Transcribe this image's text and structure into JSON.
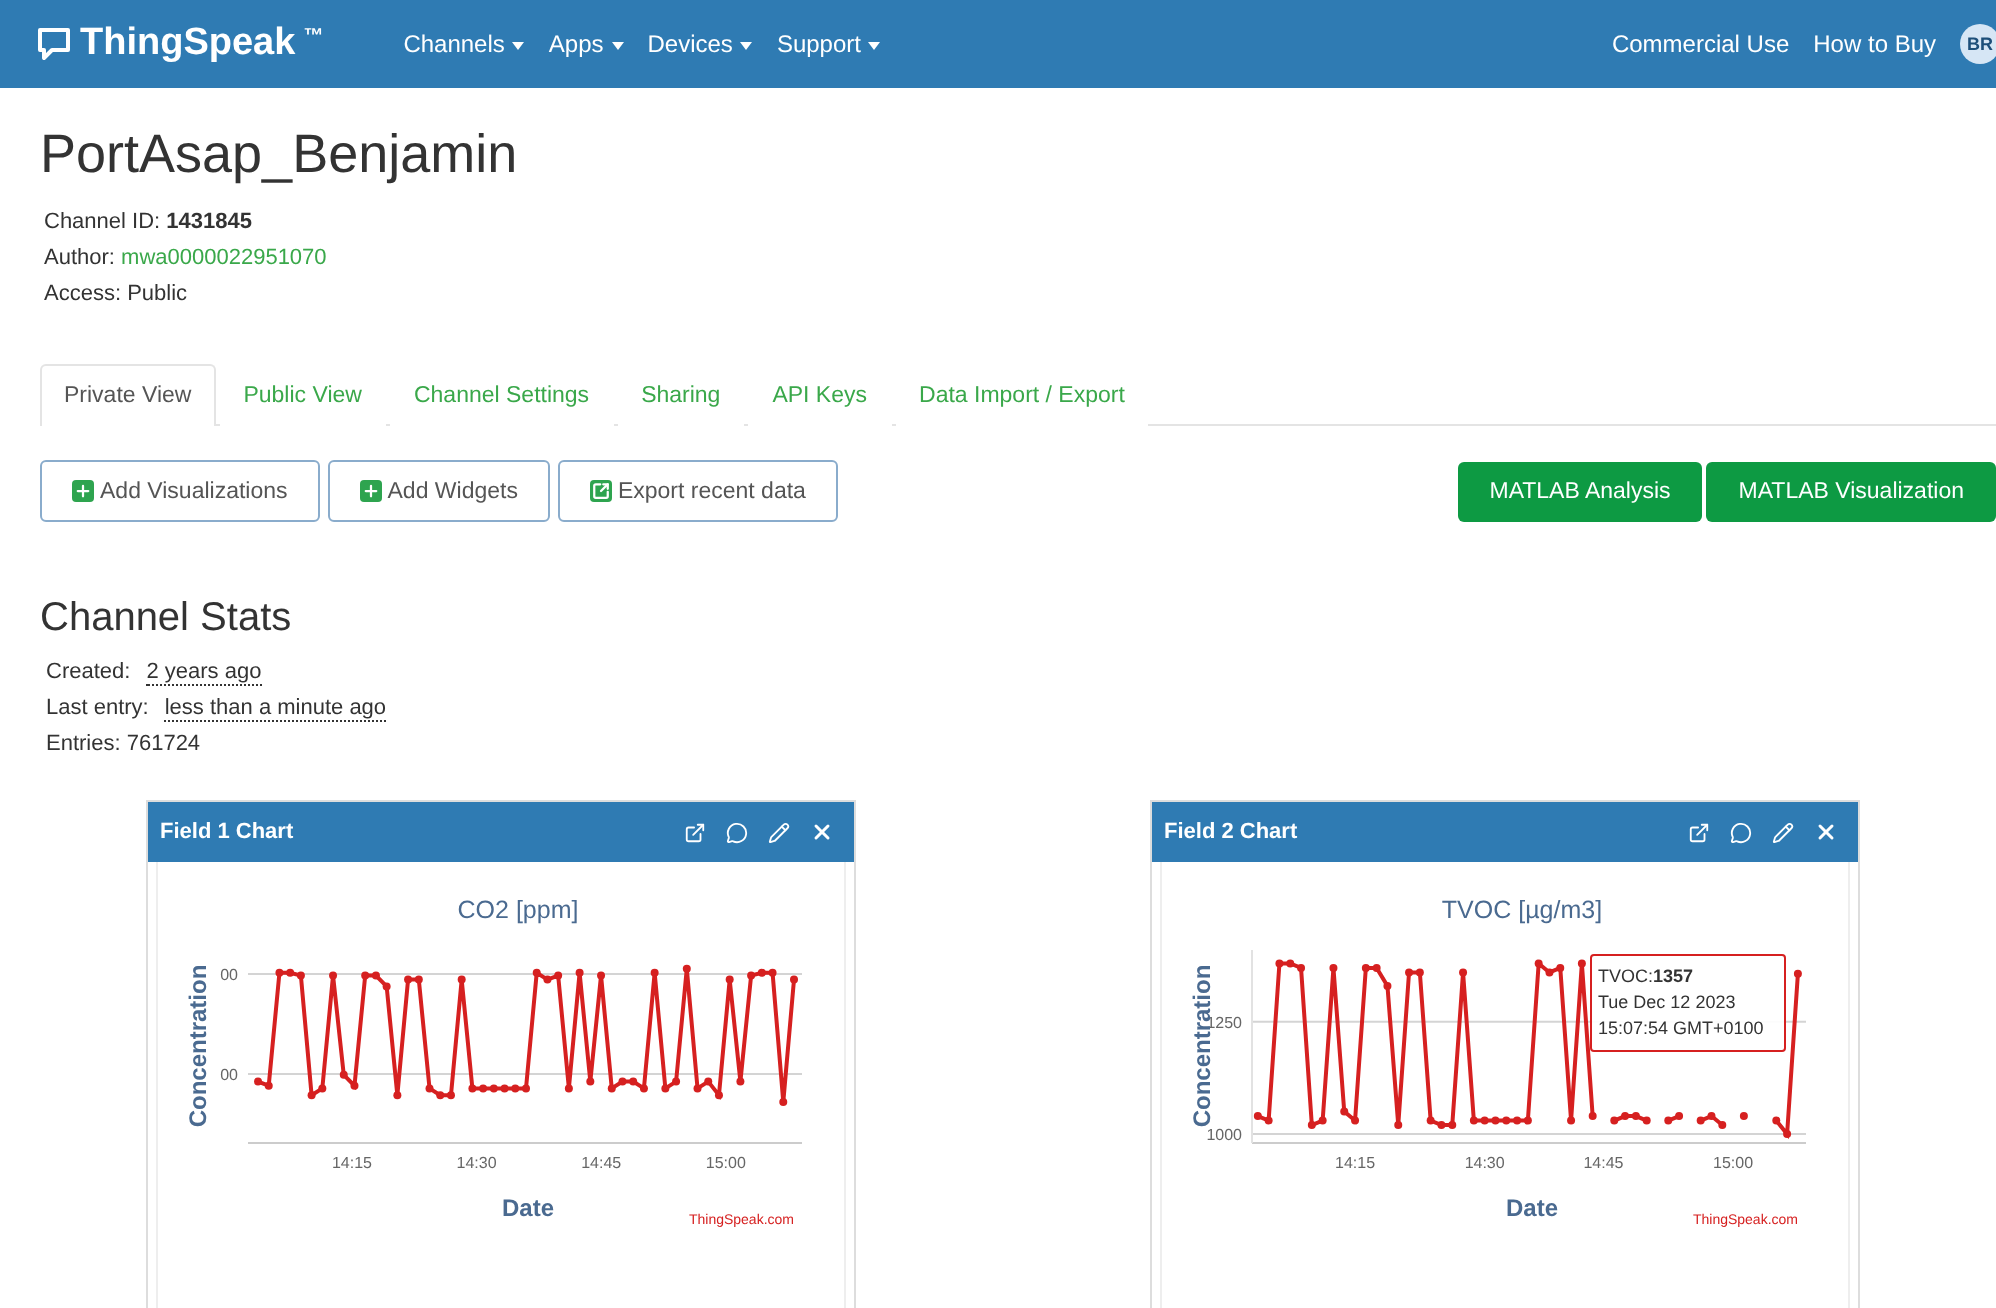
{
  "navbar": {
    "brand": "ThingSpeak",
    "trademark": "™",
    "menus": [
      {
        "label": "Channels"
      },
      {
        "label": "Apps"
      },
      {
        "label": "Devices"
      },
      {
        "label": "Support"
      }
    ],
    "links": [
      "Commercial Use",
      "How to Buy"
    ],
    "avatar": "BR"
  },
  "channel": {
    "title": "PortAsap_Benjamin",
    "id_label": "Channel ID:",
    "id": "1431845",
    "author_label": "Author:",
    "author": "mwa0000022951070",
    "access": "Access: Public"
  },
  "tabs": [
    {
      "label": "Private View",
      "selected": true
    },
    {
      "label": "Public View",
      "selected": false
    },
    {
      "label": "Channel Settings",
      "selected": false
    },
    {
      "label": "Sharing",
      "selected": false
    },
    {
      "label": "API Keys",
      "selected": false
    },
    {
      "label": "Data Import / Export",
      "selected": false
    }
  ],
  "actions": [
    {
      "label": "Add Visualizations",
      "kind": "add"
    },
    {
      "label": "Add Widgets",
      "kind": "add"
    },
    {
      "label": "Export recent data",
      "kind": "export"
    }
  ],
  "matlab_buttons": [
    "MATLAB Analysis",
    "MATLAB Visualization"
  ],
  "stats": {
    "title": "Channel Stats",
    "created_label": "Created:",
    "created": "2 years ago",
    "last_label": "Last entry:",
    "last": "less than a minute ago",
    "entries": "Entries: 761724"
  },
  "charts": [
    {
      "header": "Field 1 Chart",
      "title": "CO2 [ppm]",
      "xlabel": "Date",
      "ylabel": "Concentration",
      "x_tick_labels": [
        "14:15",
        "14:30",
        "14:45",
        "15:00"
      ],
      "y_tick_labels": [
        "00",
        "00"
      ],
      "credit": "ThingSpeak.com"
    },
    {
      "header": "Field 2 Chart",
      "credit": "ThingSpeak.com",
      "chart_data": {
        "type": "line",
        "title": "TVOC [µg/m3]",
        "xlabel": "Date",
        "ylabel": "Concentration",
        "categories": [
          null,
          null,
          null,
          null,
          null,
          null,
          null,
          null,
          null,
          "14:15",
          null,
          null,
          null,
          null,
          null,
          null,
          null,
          null,
          null,
          null,
          null,
          "14:30",
          null,
          null,
          null,
          null,
          null,
          null,
          null,
          null,
          null,
          null,
          "14:45",
          null,
          null,
          null,
          null,
          null,
          null,
          null,
          null,
          null,
          null,
          null,
          "15:00",
          null,
          null,
          null,
          null,
          null,
          null
        ],
        "series": [
          {
            "color": "#d62020",
            "marker": "circle",
            "values": [
              1040,
              1030,
              1380,
              1380,
              1370,
              1020,
              1030,
              1370,
              1050,
              1030,
              1370,
              1370,
              1330,
              1020,
              1360,
              1360,
              1030,
              1020,
              1020,
              1360,
              1030,
              1030,
              1030,
              1030,
              1030,
              1030,
              1380,
              1360,
              1370,
              1030,
              1380,
              1040,
              null,
              1030,
              1040,
              1040,
              1030,
              null,
              1030,
              1040,
              null,
              1030,
              1040,
              1020,
              null,
              1040,
              null,
              null,
              1030,
              1000,
              1357
            ]
          }
        ],
        "ylim": [
          980,
          1410
        ],
        "yticks": [
          1000,
          1250
        ]
      },
      "tooltip": {
        "value": "TVOC:**1357**",
        "date": "Tue Dec 12 2023",
        "time": "15:07:54 GMT+0100"
      }
    }
  ]
}
